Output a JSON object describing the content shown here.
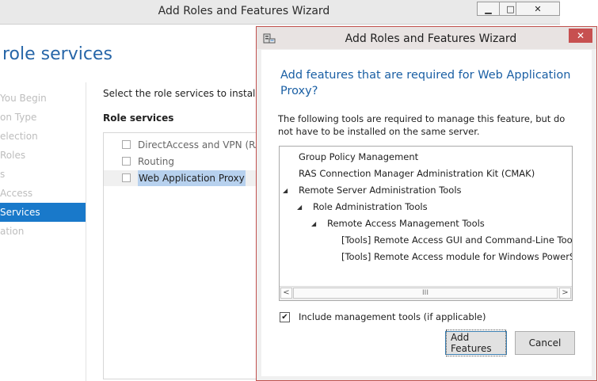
{
  "background_window": {
    "title": "Add Roles and Features Wizard",
    "minimize_glyph": "▁",
    "maximize_glyph": "□",
    "close_glyph": "✕",
    "heading": "role services",
    "nav": [
      {
        "label": "You Begin"
      },
      {
        "label": "on Type"
      },
      {
        "label": "election"
      },
      {
        "label": "Roles"
      },
      {
        "label": "s"
      },
      {
        "label": "Access"
      },
      {
        "label": "Services",
        "active": true
      },
      {
        "label": "ation"
      }
    ],
    "description": "Select the role services to install for R",
    "role_services_label": "Role services",
    "role_services": [
      {
        "label": "DirectAccess and VPN (RAS)"
      },
      {
        "label": "Routing"
      },
      {
        "label": "Web Application Proxy",
        "selected": true
      }
    ]
  },
  "dialog": {
    "title": "Add Roles and Features Wizard",
    "close_glyph": "✕",
    "heading": "Add features that are required for Web Application Proxy?",
    "description": "The following tools are required to manage this feature, but do not have to be installed on the same server.",
    "tree": [
      {
        "label": "Group Policy Management",
        "level": 0,
        "expanded": false
      },
      {
        "label": "RAS Connection Manager Administration Kit (CMAK)",
        "level": 0,
        "expanded": false
      },
      {
        "label": "Remote Server Administration Tools",
        "level": 0,
        "expanded": true
      },
      {
        "label": "Role Administration Tools",
        "level": 1,
        "expanded": true
      },
      {
        "label": "Remote Access Management Tools",
        "level": 2,
        "expanded": true
      },
      {
        "label": "[Tools] Remote Access GUI and Command-Line Tools",
        "level": 3,
        "expanded": false
      },
      {
        "label": "[Tools] Remote Access module for Windows PowerShell",
        "level": 3,
        "expanded": false
      }
    ],
    "expand_glyph": "◢",
    "scroll_left_glyph": "<",
    "scroll_right_glyph": ">",
    "scroll_thumb_glyph": "III",
    "include_tools_label": "Include management tools (if applicable)",
    "include_tools_checked": true,
    "check_glyph": "✔",
    "add_button": "Add Features",
    "cancel_button": "Cancel"
  },
  "colors": {
    "accent_blue": "#1979ca",
    "heading_blue": "#1a5fa4",
    "dialog_border": "#c0504d",
    "close_red": "#c75050"
  }
}
